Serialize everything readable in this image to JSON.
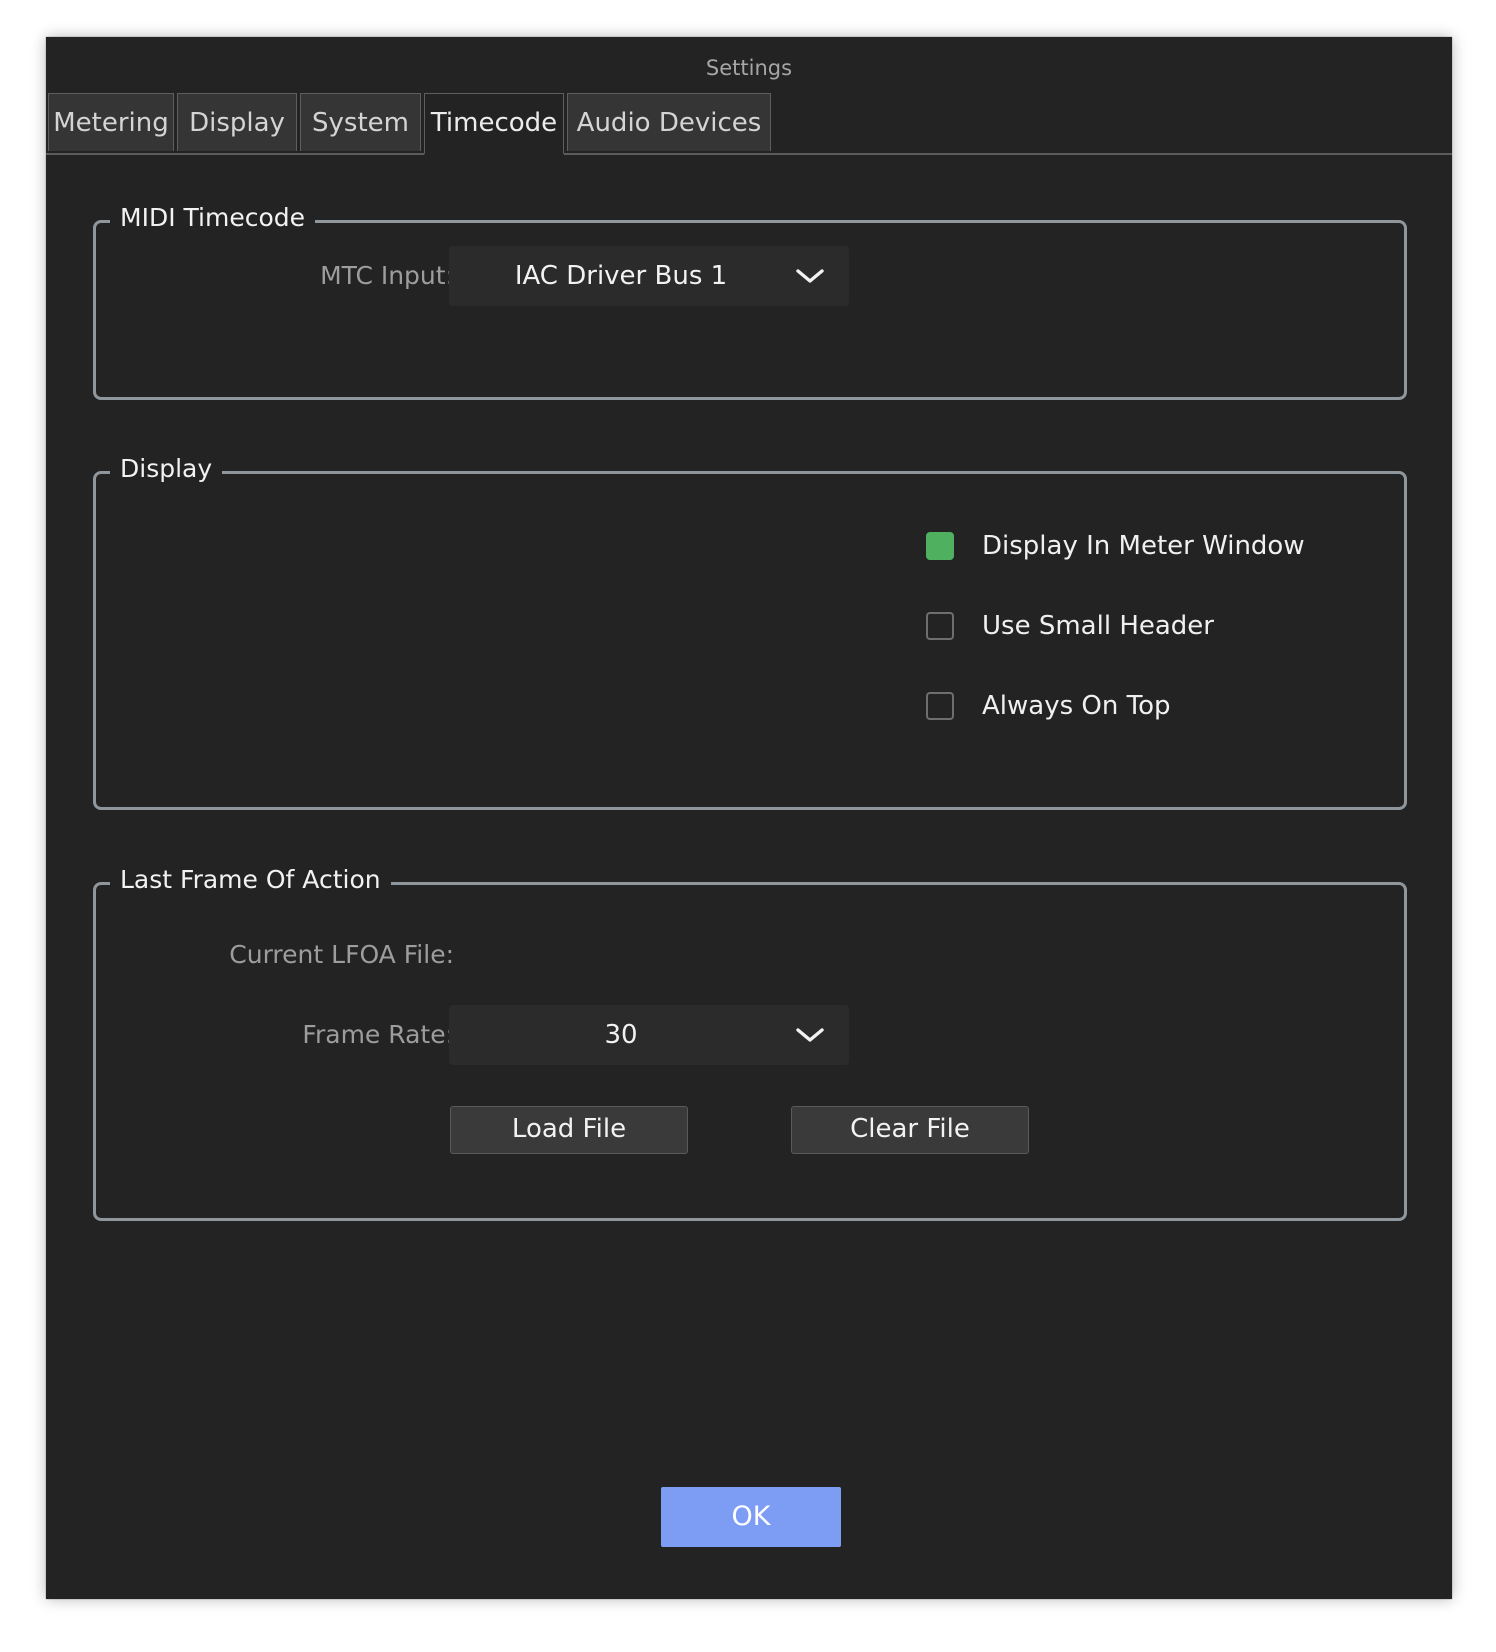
{
  "window": {
    "title": "Settings"
  },
  "tabs": [
    {
      "label": "Metering",
      "active": false
    },
    {
      "label": "Display",
      "active": false
    },
    {
      "label": "System",
      "active": false
    },
    {
      "label": "Timecode",
      "active": true
    },
    {
      "label": "Audio Devices",
      "active": false
    }
  ],
  "midi_timecode": {
    "title": "MIDI Timecode",
    "mtc_input_label": "MTC Input:",
    "mtc_input_value": "IAC Driver Bus 1",
    "dropdown_icon": "chevron-down-icon"
  },
  "display": {
    "title": "Display",
    "options": [
      {
        "label": "Display In Meter Window",
        "checked": true
      },
      {
        "label": "Use Small Header",
        "checked": false
      },
      {
        "label": "Always On Top",
        "checked": false
      }
    ]
  },
  "lfoa": {
    "title": "Last Frame Of Action",
    "current_file_label": "Current LFOA File:",
    "frame_rate_label": "Frame Rate:",
    "frame_rate_value": "30",
    "load_button": "Load File",
    "clear_button": "Clear File"
  },
  "footer": {
    "ok_button": "OK"
  },
  "colors": {
    "background": "#232323",
    "checkbox_checked": "#4fb15f",
    "ok_button": "#7d9cf4",
    "group_border": "#8f969c"
  }
}
